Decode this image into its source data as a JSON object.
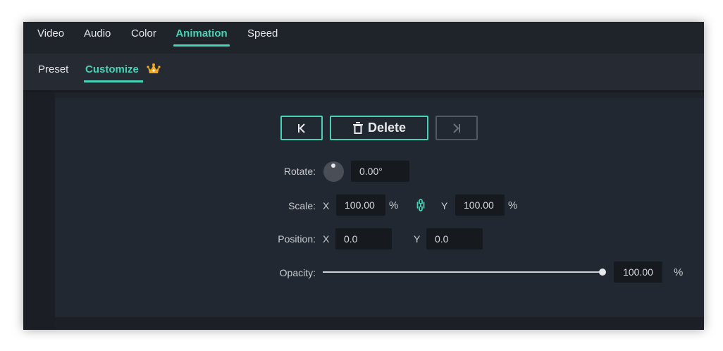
{
  "tabs": [
    {
      "label": "Video",
      "active": false
    },
    {
      "label": "Audio",
      "active": false
    },
    {
      "label": "Color",
      "active": false
    },
    {
      "label": "Animation",
      "active": true
    },
    {
      "label": "Speed",
      "active": false
    }
  ],
  "subtabs": {
    "preset": "Preset",
    "customize": "Customize",
    "customize_badge": "crown-icon"
  },
  "keyframe": {
    "prev_icon": "prev-keyframe-icon",
    "delete_label": "Delete",
    "delete_icon": "trash-icon",
    "next_icon": "next-keyframe-icon",
    "next_enabled": false
  },
  "rotate": {
    "label": "Rotate:",
    "value": "0.00°"
  },
  "scale": {
    "label": "Scale:",
    "x_label": "X",
    "x_value": "100.00",
    "x_unit": "%",
    "link_icon": "link-icon",
    "y_label": "Y",
    "y_value": "100.00",
    "y_unit": "%"
  },
  "position": {
    "label": "Position:",
    "x_label": "X",
    "x_value": "0.0",
    "y_label": "Y",
    "y_value": "0.0"
  },
  "opacity": {
    "label": "Opacity:",
    "value": "100.00",
    "unit": "%",
    "level": 1.0
  },
  "colors": {
    "accent": "#46d3b7",
    "background": "#1e2229",
    "panel": "#222831"
  }
}
